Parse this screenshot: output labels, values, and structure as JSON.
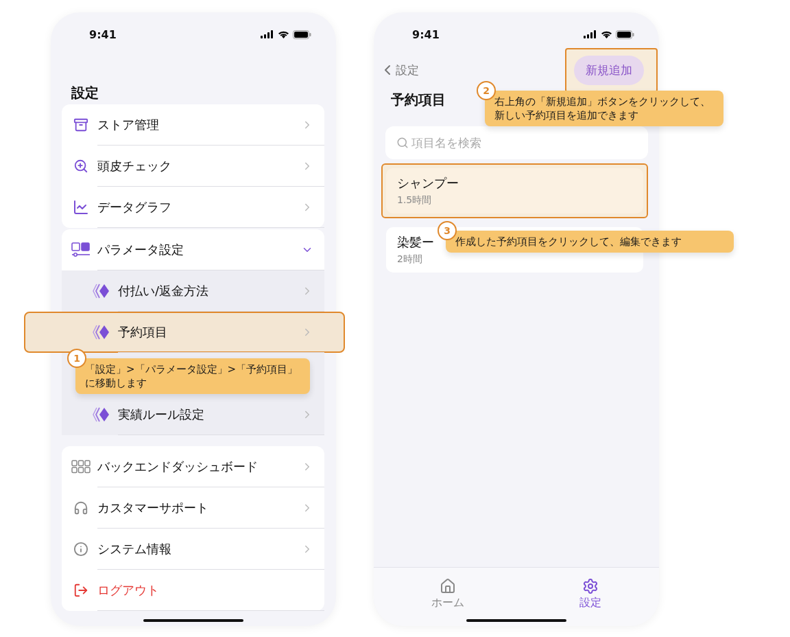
{
  "annotations": [
    {
      "number": "1",
      "text": "「設定」>「パラメータ設定」>「予約項目」に移動します"
    },
    {
      "number": "2",
      "text": "右上角の「新規追加」ボタンをクリックして、新しい予約項目を追加できます"
    },
    {
      "number": "3",
      "text": "作成した予約項目をクリックして、編集できます"
    }
  ],
  "settings_screen": {
    "status_bar": {
      "time": "9:41"
    },
    "title": "設定",
    "groups": [
      {
        "items": [
          {
            "kind": "link",
            "label": "ストア管理"
          },
          {
            "kind": "link",
            "label": "頭皮チェック"
          },
          {
            "kind": "link",
            "label": "データグラフ"
          }
        ]
      },
      {
        "items": [
          {
            "kind": "section",
            "label": "パラメータ設定",
            "expanded": true,
            "children": [
              {
                "label": "付払い/返金方法",
                "highlighted": false
              },
              {
                "label": "予約項目",
                "highlighted": true
              },
              {
                "label": "実績ルール設定",
                "highlighted": false
              }
            ]
          }
        ]
      },
      {
        "items": [
          {
            "kind": "link",
            "label": "バックエンドダッシュボード"
          },
          {
            "kind": "link",
            "label": "カスタマーサポート"
          },
          {
            "kind": "link",
            "label": "システム情報"
          },
          {
            "kind": "logout",
            "label": "ログアウト"
          }
        ]
      }
    ]
  },
  "reservation_screen": {
    "status_bar": {
      "time": "9:41"
    },
    "back_label": "設定",
    "add_button": {
      "label": "新規追加",
      "highlighted": true
    },
    "title": "予約項目",
    "search": {
      "placeholder": "項目名を検索"
    },
    "items": [
      {
        "name": "シャンプー",
        "duration": "1.5時間",
        "highlighted": true
      },
      {
        "name": "染髪ー",
        "duration": "2時間",
        "highlighted": false
      }
    ],
    "tab_bar": [
      {
        "label": "ホーム",
        "selected": false
      },
      {
        "label": "設定",
        "selected": true
      }
    ]
  }
}
